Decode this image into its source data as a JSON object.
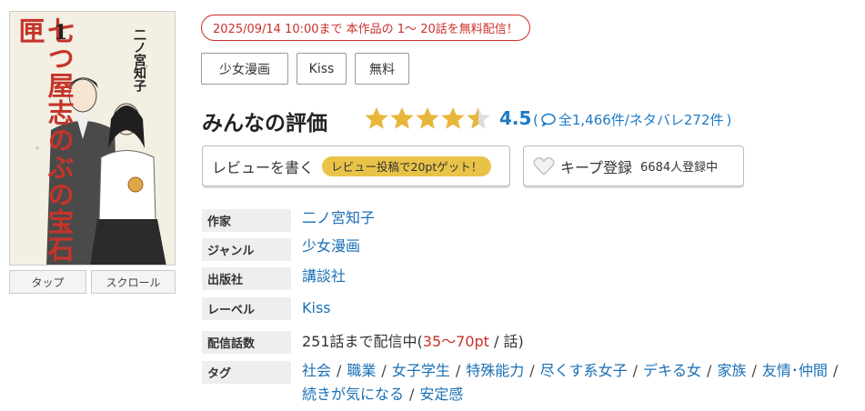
{
  "cover": {
    "title_vertical": "七つ屋志のぶの宝石匣",
    "author_vertical": "二ノ宮知子",
    "volume": "1"
  },
  "view_buttons": {
    "tap": "タップ",
    "scroll": "スクロール"
  },
  "free_banner": "2025/09/14 10:00まで 本作品の 1〜 20話を無料配信！",
  "tag_buttons": [
    "少女漫画",
    "Kiss",
    "無料"
  ],
  "rating": {
    "title": "みんなの評価",
    "score": "4.5",
    "stars": 4.5,
    "counts": "全1,466件/ネタバレ272件",
    "open_paren": "(",
    "close_paren": ")",
    "star_color": "#e8b73a"
  },
  "review_button": {
    "label": "レビューを書く",
    "badge": "レビュー投稿で20ptゲット！"
  },
  "keep_button": {
    "label": "キープ登録",
    "count": "6684人登録中"
  },
  "info": {
    "author_label": "作家",
    "author_value": "二ノ宮知子",
    "genre_label": "ジャンル",
    "genre_value": "少女漫画",
    "publisher_label": "出版社",
    "publisher_value": "講談社",
    "label_label": "レーベル",
    "label_value": "Kiss",
    "episodes_label": "配信話数",
    "episodes_prefix": "251話まで配信中(",
    "episodes_price": "35〜70pt",
    "episodes_suffix": " / 話)",
    "tags_label": "タグ",
    "tags": [
      "社会",
      "職業",
      "女子学生",
      "特殊能力",
      "尽くす系女子",
      "デキる女",
      "家族",
      "友情･仲間",
      "続きが気になる",
      "安定感"
    ]
  }
}
